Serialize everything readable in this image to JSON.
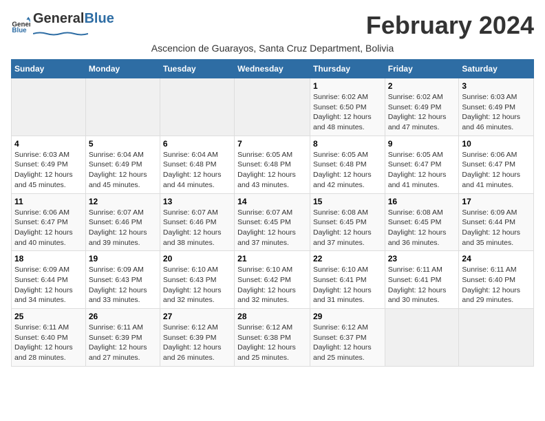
{
  "logo": {
    "text_general": "General",
    "text_blue": "Blue"
  },
  "title": "February 2024",
  "subtitle": "Ascencion de Guarayos, Santa Cruz Department, Bolivia",
  "days_of_week": [
    "Sunday",
    "Monday",
    "Tuesday",
    "Wednesday",
    "Thursday",
    "Friday",
    "Saturday"
  ],
  "weeks": [
    [
      {
        "day": "",
        "info": ""
      },
      {
        "day": "",
        "info": ""
      },
      {
        "day": "",
        "info": ""
      },
      {
        "day": "",
        "info": ""
      },
      {
        "day": "1",
        "info": "Sunrise: 6:02 AM\nSunset: 6:50 PM\nDaylight: 12 hours and 48 minutes."
      },
      {
        "day": "2",
        "info": "Sunrise: 6:02 AM\nSunset: 6:49 PM\nDaylight: 12 hours and 47 minutes."
      },
      {
        "day": "3",
        "info": "Sunrise: 6:03 AM\nSunset: 6:49 PM\nDaylight: 12 hours and 46 minutes."
      }
    ],
    [
      {
        "day": "4",
        "info": "Sunrise: 6:03 AM\nSunset: 6:49 PM\nDaylight: 12 hours and 45 minutes."
      },
      {
        "day": "5",
        "info": "Sunrise: 6:04 AM\nSunset: 6:49 PM\nDaylight: 12 hours and 45 minutes."
      },
      {
        "day": "6",
        "info": "Sunrise: 6:04 AM\nSunset: 6:48 PM\nDaylight: 12 hours and 44 minutes."
      },
      {
        "day": "7",
        "info": "Sunrise: 6:05 AM\nSunset: 6:48 PM\nDaylight: 12 hours and 43 minutes."
      },
      {
        "day": "8",
        "info": "Sunrise: 6:05 AM\nSunset: 6:48 PM\nDaylight: 12 hours and 42 minutes."
      },
      {
        "day": "9",
        "info": "Sunrise: 6:05 AM\nSunset: 6:47 PM\nDaylight: 12 hours and 41 minutes."
      },
      {
        "day": "10",
        "info": "Sunrise: 6:06 AM\nSunset: 6:47 PM\nDaylight: 12 hours and 41 minutes."
      }
    ],
    [
      {
        "day": "11",
        "info": "Sunrise: 6:06 AM\nSunset: 6:47 PM\nDaylight: 12 hours and 40 minutes."
      },
      {
        "day": "12",
        "info": "Sunrise: 6:07 AM\nSunset: 6:46 PM\nDaylight: 12 hours and 39 minutes."
      },
      {
        "day": "13",
        "info": "Sunrise: 6:07 AM\nSunset: 6:46 PM\nDaylight: 12 hours and 38 minutes."
      },
      {
        "day": "14",
        "info": "Sunrise: 6:07 AM\nSunset: 6:45 PM\nDaylight: 12 hours and 37 minutes."
      },
      {
        "day": "15",
        "info": "Sunrise: 6:08 AM\nSunset: 6:45 PM\nDaylight: 12 hours and 37 minutes."
      },
      {
        "day": "16",
        "info": "Sunrise: 6:08 AM\nSunset: 6:45 PM\nDaylight: 12 hours and 36 minutes."
      },
      {
        "day": "17",
        "info": "Sunrise: 6:09 AM\nSunset: 6:44 PM\nDaylight: 12 hours and 35 minutes."
      }
    ],
    [
      {
        "day": "18",
        "info": "Sunrise: 6:09 AM\nSunset: 6:44 PM\nDaylight: 12 hours and 34 minutes."
      },
      {
        "day": "19",
        "info": "Sunrise: 6:09 AM\nSunset: 6:43 PM\nDaylight: 12 hours and 33 minutes."
      },
      {
        "day": "20",
        "info": "Sunrise: 6:10 AM\nSunset: 6:43 PM\nDaylight: 12 hours and 32 minutes."
      },
      {
        "day": "21",
        "info": "Sunrise: 6:10 AM\nSunset: 6:42 PM\nDaylight: 12 hours and 32 minutes."
      },
      {
        "day": "22",
        "info": "Sunrise: 6:10 AM\nSunset: 6:41 PM\nDaylight: 12 hours and 31 minutes."
      },
      {
        "day": "23",
        "info": "Sunrise: 6:11 AM\nSunset: 6:41 PM\nDaylight: 12 hours and 30 minutes."
      },
      {
        "day": "24",
        "info": "Sunrise: 6:11 AM\nSunset: 6:40 PM\nDaylight: 12 hours and 29 minutes."
      }
    ],
    [
      {
        "day": "25",
        "info": "Sunrise: 6:11 AM\nSunset: 6:40 PM\nDaylight: 12 hours and 28 minutes."
      },
      {
        "day": "26",
        "info": "Sunrise: 6:11 AM\nSunset: 6:39 PM\nDaylight: 12 hours and 27 minutes."
      },
      {
        "day": "27",
        "info": "Sunrise: 6:12 AM\nSunset: 6:39 PM\nDaylight: 12 hours and 26 minutes."
      },
      {
        "day": "28",
        "info": "Sunrise: 6:12 AM\nSunset: 6:38 PM\nDaylight: 12 hours and 25 minutes."
      },
      {
        "day": "29",
        "info": "Sunrise: 6:12 AM\nSunset: 6:37 PM\nDaylight: 12 hours and 25 minutes."
      },
      {
        "day": "",
        "info": ""
      },
      {
        "day": "",
        "info": ""
      }
    ]
  ]
}
